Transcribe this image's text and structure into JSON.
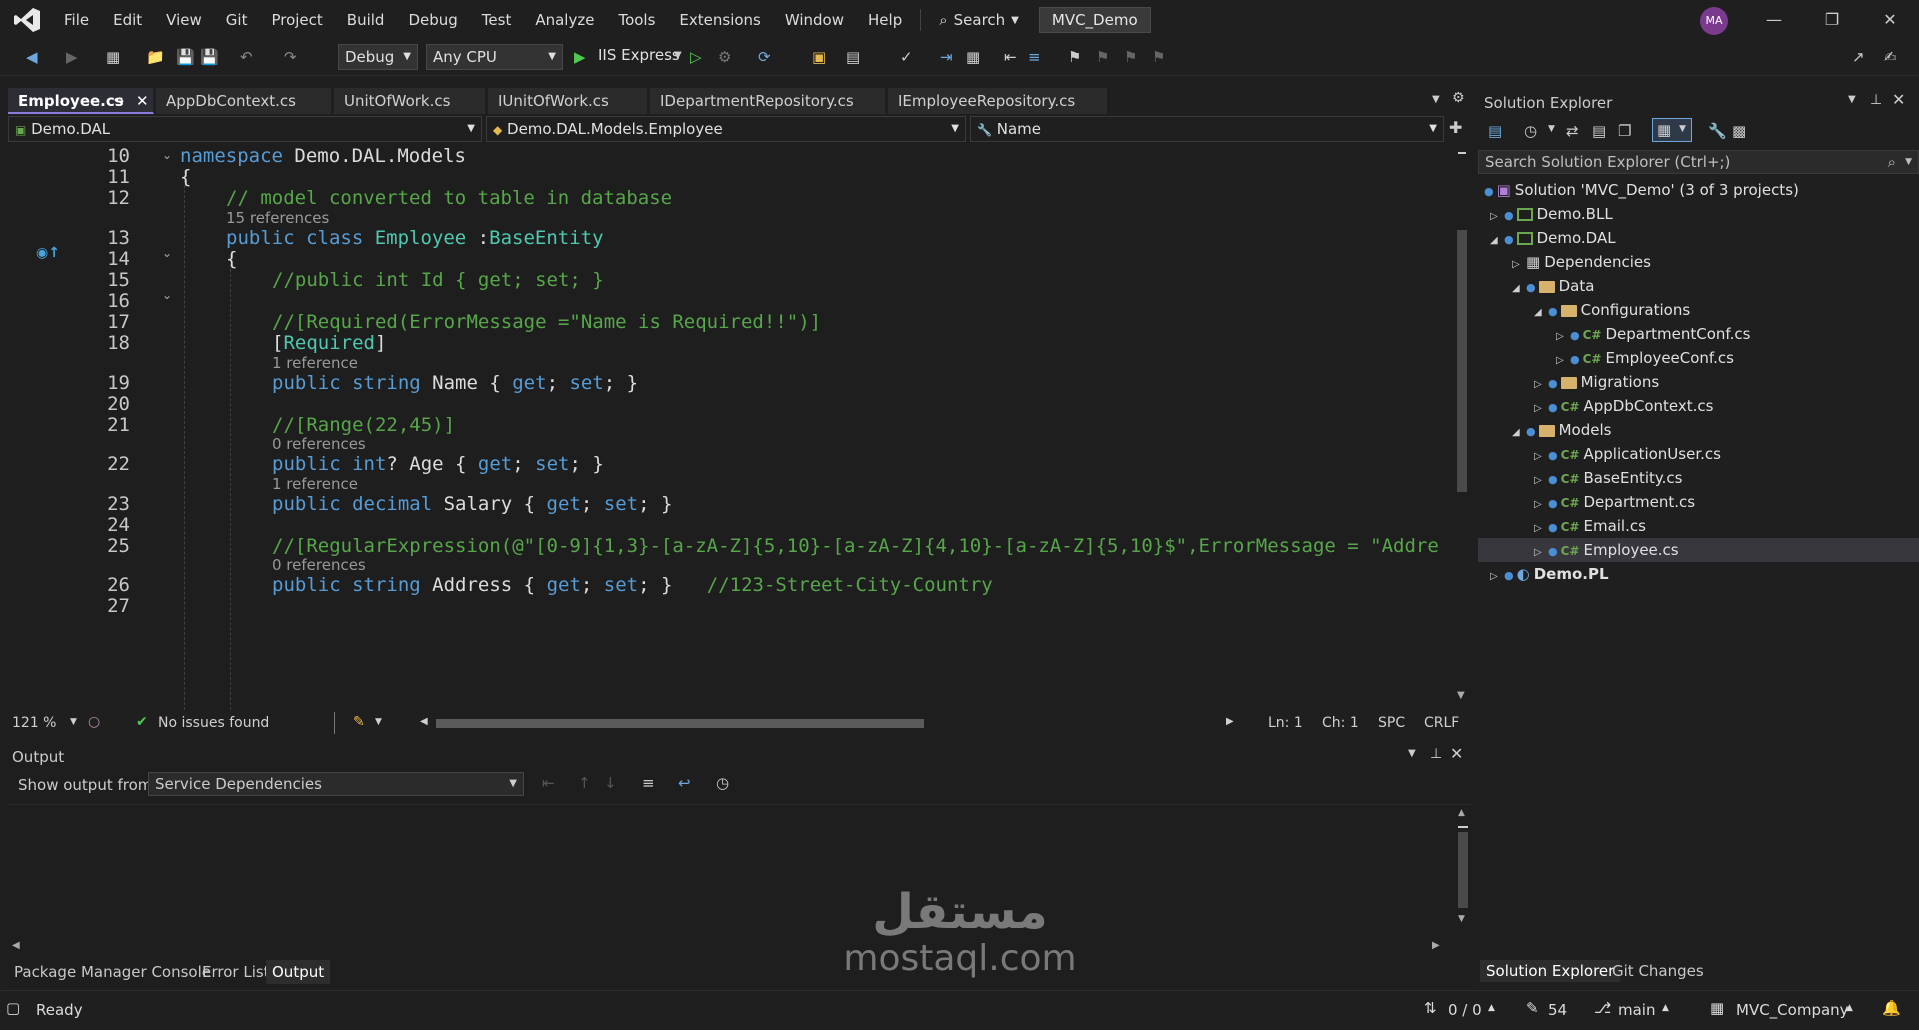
{
  "menu": [
    "File",
    "Edit",
    "View",
    "Git",
    "Project",
    "Build",
    "Debug",
    "Test",
    "Analyze",
    "Tools",
    "Extensions",
    "Window",
    "Help"
  ],
  "search_label": "Search",
  "solution_name": "MVC_Demo",
  "avatar_initials": "MA",
  "toolbar": {
    "config": "Debug",
    "platform": "Any CPU",
    "run_target": "IIS Express"
  },
  "tabs": [
    "Employee.cs",
    "AppDbContext.cs",
    "UnitOfWork.cs",
    "IUnitOfWork.cs",
    "IDepartmentRepository.cs",
    "IEmployeeRepository.cs"
  ],
  "nav": {
    "project": "Demo.DAL",
    "type": "Demo.DAL.Models.Employee",
    "member": "Name"
  },
  "code": {
    "line_numbers": [
      "10",
      "11",
      "12",
      "13",
      "14",
      "15",
      "16",
      "17",
      "18",
      "19",
      "20",
      "21",
      "22",
      "23",
      "24",
      "25",
      "26",
      "27"
    ],
    "l10_kw": "namespace",
    "l10_rest": " Demo.DAL.Models",
    "l11": "{",
    "l12": "// model converted to table in database",
    "lens_class": "15 references",
    "l13_kw": "public class ",
    "l13_cls": "Employee",
    "l13_sep": " :",
    "l13_base": "BaseEntity",
    "l14": "{",
    "l15": "//public int Id { get; set; }",
    "l17": "//[Required(ErrorMessage =\"Name is Required!!\")]",
    "l18_open": "[",
    "l18_attr": "Required",
    "l18_close": "]",
    "lens_name": "1 reference",
    "l19_kw": "public string",
    "l19_rest": " Name { ",
    "l19_get": "get",
    "l19_mid": "; ",
    "l19_set": "set",
    "l19_end": "; }",
    "l21": "//[Range(22,45)]",
    "lens_age": "0 references",
    "l22_kw": "public int",
    "l22_rest": "? Age { ",
    "l22_get": "get",
    "l22_mid": "; ",
    "l22_set": "set",
    "l22_end": "; }",
    "lens_salary": "1 reference",
    "l23_kw": "public decimal",
    "l23_rest": " Salary { ",
    "l23_get": "get",
    "l23_mid": "; ",
    "l23_set": "set",
    "l23_end": "; }",
    "l25": "//[RegularExpression(@\"[0-9]{1,3}-[a-zA-Z]{5,10}-[a-zA-Z]{4,10}-[a-zA-Z]{5,10}$\",ErrorMessage = \"Addre",
    "lens_address": "0 references",
    "l26_kw": "public string",
    "l26_rest": " Address { ",
    "l26_get": "get",
    "l26_mid": "; ",
    "l26_set": "set",
    "l26_end": "; }",
    "l26_cm": "//123-Street-City-Country"
  },
  "editor_status": {
    "zoom": "121 %",
    "issues": "No issues found",
    "line": "Ln: 1",
    "col": "Ch: 1",
    "whitespace": "SPC",
    "eol": "CRLF"
  },
  "output": {
    "title": "Output",
    "show_from_label": "Show output from:",
    "source": "Service Dependencies"
  },
  "bottom_tabs": [
    "Package Manager Console",
    "Error List",
    "Output"
  ],
  "solution_explorer": {
    "title": "Solution Explorer",
    "search_placeholder": "Search Solution Explorer (Ctrl+;)",
    "tree": [
      {
        "label": "Solution 'MVC_Demo' (3 of 3 projects)",
        "kind": "solution"
      },
      {
        "label": "Demo.BLL",
        "kind": "project"
      },
      {
        "label": "Demo.DAL",
        "kind": "project"
      },
      {
        "label": "Dependencies",
        "kind": "deps"
      },
      {
        "label": "Data",
        "kind": "folder"
      },
      {
        "label": "Configurations",
        "kind": "folder"
      },
      {
        "label": "DepartmentConf.cs",
        "kind": "cs"
      },
      {
        "label": "EmployeeConf.cs",
        "kind": "cs"
      },
      {
        "label": "Migrations",
        "kind": "folder"
      },
      {
        "label": "AppDbContext.cs",
        "kind": "cs"
      },
      {
        "label": "Models",
        "kind": "folder"
      },
      {
        "label": "ApplicationUser.cs",
        "kind": "cs"
      },
      {
        "label": "BaseEntity.cs",
        "kind": "cs"
      },
      {
        "label": "Department.cs",
        "kind": "cs"
      },
      {
        "label": "Email.cs",
        "kind": "cs"
      },
      {
        "label": "Employee.cs",
        "kind": "cs"
      },
      {
        "label": "Demo.PL",
        "kind": "project"
      }
    ],
    "tabs": [
      "Solution Explorer",
      "Git Changes"
    ]
  },
  "statusbar": {
    "state": "Ready",
    "sync": "0 / 0",
    "edits": "54",
    "branch": "main",
    "repo": "MVC_Company"
  },
  "watermark": {
    "arabic": "مستقل",
    "latin": "mostaql.com"
  },
  "colors": {
    "accent": "#8e79dd",
    "keyword": "#569cd6",
    "type": "#4ec9b0",
    "comment": "#57a64a"
  }
}
